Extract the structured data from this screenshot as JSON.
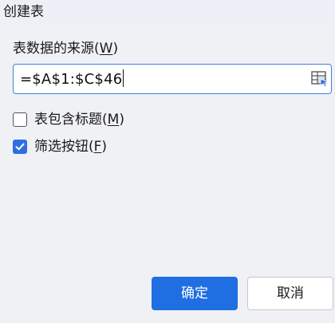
{
  "window": {
    "title": "创建表"
  },
  "range": {
    "label": "表数据的来源(",
    "label_mnemonic": "W",
    "label_suffix": ")",
    "value": "=$A$1:$C$46",
    "picker_icon": "range-select-icon"
  },
  "options": {
    "has_header": {
      "label": "表包含标题(",
      "mnemonic": "M",
      "suffix": ")",
      "checked": false
    },
    "filter_buttons": {
      "label": "筛选按钮(",
      "mnemonic": "F",
      "suffix": ")",
      "checked": true
    }
  },
  "buttons": {
    "ok": "确定",
    "cancel": "取消"
  },
  "colors": {
    "accent": "#1f6fe3",
    "background": "#f0f1f5"
  }
}
